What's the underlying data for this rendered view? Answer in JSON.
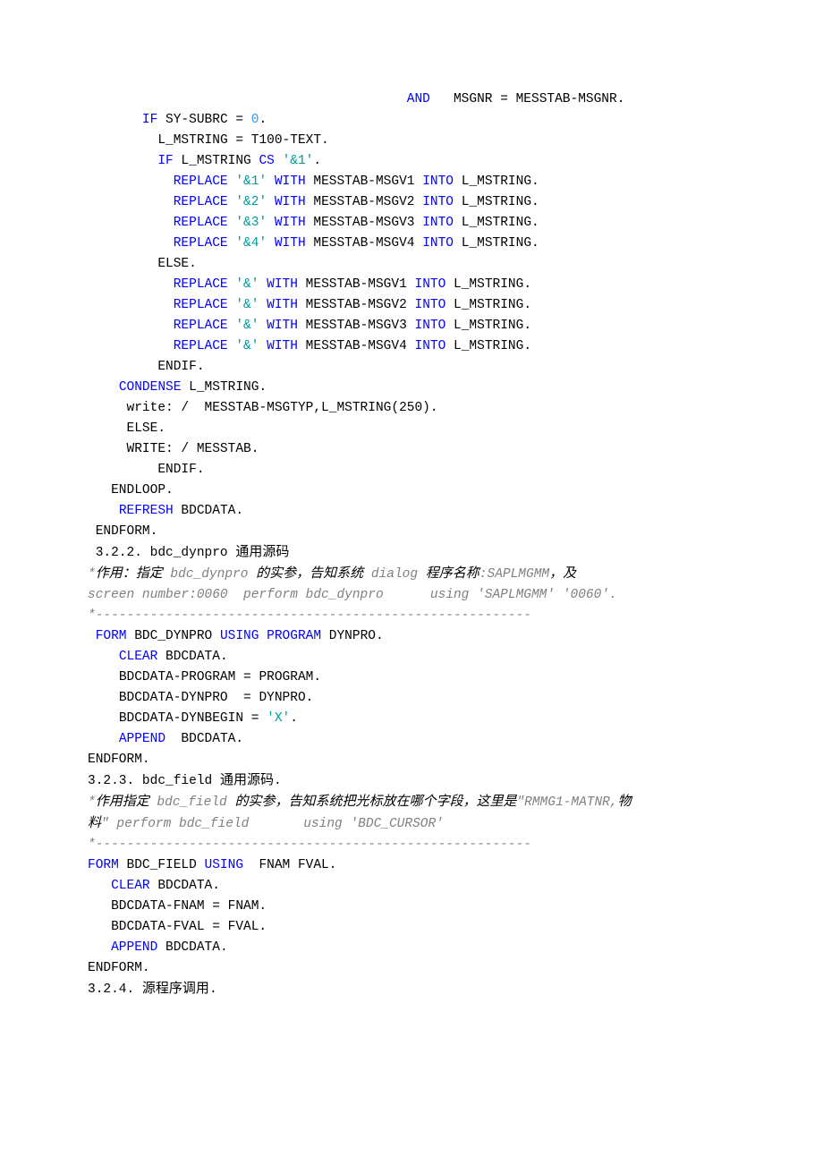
{
  "lines": [
    {
      "indent": 41,
      "spans": [
        {
          "cls": "kw",
          "t": "AND"
        },
        {
          "cls": "",
          "t": "   MSGNR = MESSTAB-MSGNR."
        }
      ]
    },
    {
      "indent": 7,
      "spans": [
        {
          "cls": "kw",
          "t": "IF"
        },
        {
          "cls": "",
          "t": " SY-SUBRC = "
        },
        {
          "cls": "num",
          "t": "0"
        },
        {
          "cls": "",
          "t": "."
        }
      ]
    },
    {
      "indent": 9,
      "spans": [
        {
          "cls": "",
          "t": "L_MSTRING = T100-TEXT."
        }
      ]
    },
    {
      "indent": 9,
      "spans": [
        {
          "cls": "kw",
          "t": "IF"
        },
        {
          "cls": "",
          "t": " L_MSTRING "
        },
        {
          "cls": "kw",
          "t": "CS"
        },
        {
          "cls": "",
          "t": " "
        },
        {
          "cls": "str",
          "t": "'&1'"
        },
        {
          "cls": "",
          "t": "."
        }
      ]
    },
    {
      "indent": 11,
      "spans": [
        {
          "cls": "kw",
          "t": "REPLACE"
        },
        {
          "cls": "",
          "t": " "
        },
        {
          "cls": "str",
          "t": "'&1'"
        },
        {
          "cls": "",
          "t": " "
        },
        {
          "cls": "kw",
          "t": "WITH"
        },
        {
          "cls": "",
          "t": " MESSTAB-MSGV1 "
        },
        {
          "cls": "kw",
          "t": "INTO"
        },
        {
          "cls": "",
          "t": " L_MSTRING."
        }
      ]
    },
    {
      "indent": 11,
      "spans": [
        {
          "cls": "kw",
          "t": "REPLACE"
        },
        {
          "cls": "",
          "t": " "
        },
        {
          "cls": "str",
          "t": "'&2'"
        },
        {
          "cls": "",
          "t": " "
        },
        {
          "cls": "kw",
          "t": "WITH"
        },
        {
          "cls": "",
          "t": " MESSTAB-MSGV2 "
        },
        {
          "cls": "kw",
          "t": "INTO"
        },
        {
          "cls": "",
          "t": " L_MSTRING."
        }
      ]
    },
    {
      "indent": 11,
      "spans": [
        {
          "cls": "kw",
          "t": "REPLACE"
        },
        {
          "cls": "",
          "t": " "
        },
        {
          "cls": "str",
          "t": "'&3'"
        },
        {
          "cls": "",
          "t": " "
        },
        {
          "cls": "kw",
          "t": "WITH"
        },
        {
          "cls": "",
          "t": " MESSTAB-MSGV3 "
        },
        {
          "cls": "kw",
          "t": "INTO"
        },
        {
          "cls": "",
          "t": " L_MSTRING."
        }
      ]
    },
    {
      "indent": 11,
      "spans": [
        {
          "cls": "kw",
          "t": "REPLACE"
        },
        {
          "cls": "",
          "t": " "
        },
        {
          "cls": "str",
          "t": "'&4'"
        },
        {
          "cls": "",
          "t": " "
        },
        {
          "cls": "kw",
          "t": "WITH"
        },
        {
          "cls": "",
          "t": " MESSTAB-MSGV4 "
        },
        {
          "cls": "kw",
          "t": "INTO"
        },
        {
          "cls": "",
          "t": " L_MSTRING."
        }
      ]
    },
    {
      "indent": 9,
      "spans": [
        {
          "cls": "",
          "t": "ELSE."
        }
      ]
    },
    {
      "indent": 11,
      "spans": [
        {
          "cls": "kw",
          "t": "REPLACE"
        },
        {
          "cls": "",
          "t": " "
        },
        {
          "cls": "str",
          "t": "'&'"
        },
        {
          "cls": "",
          "t": " "
        },
        {
          "cls": "kw",
          "t": "WITH"
        },
        {
          "cls": "",
          "t": " MESSTAB-MSGV1 "
        },
        {
          "cls": "kw",
          "t": "INTO"
        },
        {
          "cls": "",
          "t": " L_MSTRING."
        }
      ]
    },
    {
      "indent": 11,
      "spans": [
        {
          "cls": "kw",
          "t": "REPLACE"
        },
        {
          "cls": "",
          "t": " "
        },
        {
          "cls": "str",
          "t": "'&'"
        },
        {
          "cls": "",
          "t": " "
        },
        {
          "cls": "kw",
          "t": "WITH"
        },
        {
          "cls": "",
          "t": " MESSTAB-MSGV2 "
        },
        {
          "cls": "kw",
          "t": "INTO"
        },
        {
          "cls": "",
          "t": " L_MSTRING."
        }
      ]
    },
    {
      "indent": 11,
      "spans": [
        {
          "cls": "kw",
          "t": "REPLACE"
        },
        {
          "cls": "",
          "t": " "
        },
        {
          "cls": "str",
          "t": "'&'"
        },
        {
          "cls": "",
          "t": " "
        },
        {
          "cls": "kw",
          "t": "WITH"
        },
        {
          "cls": "",
          "t": " MESSTAB-MSGV3 "
        },
        {
          "cls": "kw",
          "t": "INTO"
        },
        {
          "cls": "",
          "t": " L_MSTRING."
        }
      ]
    },
    {
      "indent": 11,
      "spans": [
        {
          "cls": "kw",
          "t": "REPLACE"
        },
        {
          "cls": "",
          "t": " "
        },
        {
          "cls": "str",
          "t": "'&'"
        },
        {
          "cls": "",
          "t": " "
        },
        {
          "cls": "kw",
          "t": "WITH"
        },
        {
          "cls": "",
          "t": " MESSTAB-MSGV4 "
        },
        {
          "cls": "kw",
          "t": "INTO"
        },
        {
          "cls": "",
          "t": " L_MSTRING."
        }
      ]
    },
    {
      "indent": 9,
      "spans": [
        {
          "cls": "",
          "t": "ENDIF."
        }
      ]
    },
    {
      "indent": 4,
      "spans": [
        {
          "cls": "kw",
          "t": "CONDENSE"
        },
        {
          "cls": "",
          "t": " L_MSTRING."
        }
      ]
    },
    {
      "indent": 5,
      "spans": [
        {
          "cls": "",
          "t": "write: /  MESSTAB-MSGTYP,L_MSTRING(250)."
        }
      ]
    },
    {
      "indent": 5,
      "spans": [
        {
          "cls": "",
          "t": "ELSE."
        }
      ]
    },
    {
      "indent": 5,
      "spans": [
        {
          "cls": "",
          "t": "WRITE: / MESSTAB."
        }
      ]
    },
    {
      "indent": 9,
      "spans": [
        {
          "cls": "",
          "t": "ENDIF."
        }
      ]
    },
    {
      "indent": 3,
      "spans": [
        {
          "cls": "",
          "t": "ENDLOOP."
        }
      ]
    },
    {
      "indent": 4,
      "spans": [
        {
          "cls": "kw",
          "t": "REFRESH"
        },
        {
          "cls": "",
          "t": " BDCDATA."
        }
      ]
    },
    {
      "indent": 1,
      "spans": [
        {
          "cls": "",
          "t": "ENDFORM."
        }
      ]
    },
    {
      "indent": 1,
      "spans": [
        {
          "cls": "",
          "t": "3.2.2. bdc_dynpro "
        },
        {
          "cls": "cn",
          "t": "通用源码"
        }
      ]
    },
    {
      "indent": 0,
      "spans": [
        {
          "cls": "cm",
          "t": "*"
        },
        {
          "cls": "cncm",
          "t": "作用：指定"
        },
        {
          "cls": "cm",
          "t": " bdc_dynpro "
        },
        {
          "cls": "cncm",
          "t": "的实参，告知系统"
        },
        {
          "cls": "cm",
          "t": " dialog "
        },
        {
          "cls": "cncm",
          "t": "程序名称"
        },
        {
          "cls": "cm",
          "t": ":SAPLMGMM"
        },
        {
          "cls": "cncm",
          "t": "，及"
        }
      ]
    },
    {
      "indent": 0,
      "spans": [
        {
          "cls": "cm",
          "t": "screen number:0060  perform bdc_dynpro      using 'SAPLMGMM' '0060'."
        }
      ]
    },
    {
      "indent": 0,
      "spans": [
        {
          "cls": "cm",
          "t": "*--------------------------------------------------------"
        }
      ]
    },
    {
      "indent": 1,
      "spans": [
        {
          "cls": "kw",
          "t": "FORM"
        },
        {
          "cls": "",
          "t": " BDC_DYNPRO "
        },
        {
          "cls": "kw",
          "t": "USING"
        },
        {
          "cls": "",
          "t": " "
        },
        {
          "cls": "kw",
          "t": "PROGRAM"
        },
        {
          "cls": "",
          "t": " DYNPRO."
        }
      ]
    },
    {
      "indent": 4,
      "spans": [
        {
          "cls": "kw",
          "t": "CLEAR"
        },
        {
          "cls": "",
          "t": " BDCDATA."
        }
      ]
    },
    {
      "indent": 4,
      "spans": [
        {
          "cls": "",
          "t": "BDCDATA-PROGRAM = PROGRAM."
        }
      ]
    },
    {
      "indent": 4,
      "spans": [
        {
          "cls": "",
          "t": "BDCDATA-DYNPRO  = DYNPRO."
        }
      ]
    },
    {
      "indent": 4,
      "spans": [
        {
          "cls": "",
          "t": "BDCDATA-DYNBEGIN = "
        },
        {
          "cls": "str",
          "t": "'X'"
        },
        {
          "cls": "",
          "t": "."
        }
      ]
    },
    {
      "indent": 4,
      "spans": [
        {
          "cls": "kw",
          "t": "APPEND"
        },
        {
          "cls": "",
          "t": "  BDCDATA."
        }
      ]
    },
    {
      "indent": 0,
      "spans": [
        {
          "cls": "",
          "t": "ENDFORM."
        }
      ]
    },
    {
      "indent": 0,
      "spans": [
        {
          "cls": "",
          "t": "3.2.3. bdc_field "
        },
        {
          "cls": "cn",
          "t": "通用源码"
        },
        {
          "cls": "",
          "t": "."
        }
      ]
    },
    {
      "indent": 0,
      "spans": [
        {
          "cls": "cm",
          "t": "*"
        },
        {
          "cls": "cncm",
          "t": "作用指定"
        },
        {
          "cls": "cm",
          "t": " bdc_field "
        },
        {
          "cls": "cncm",
          "t": "的实参，告知系统把光标放在哪个字段，这里是"
        },
        {
          "cls": "cm",
          "t": "\"RMMG1-MATNR,"
        },
        {
          "cls": "cncm",
          "t": "物"
        }
      ]
    },
    {
      "indent": 0,
      "spans": [
        {
          "cls": "cncm",
          "t": "料"
        },
        {
          "cls": "cm",
          "t": "\" perform bdc_field       using 'BDC_CURSOR'"
        }
      ]
    },
    {
      "indent": 0,
      "spans": [
        {
          "cls": "cm",
          "t": "*--------------------------------------------------------"
        }
      ]
    },
    {
      "indent": 0,
      "spans": [
        {
          "cls": "kw",
          "t": "FORM"
        },
        {
          "cls": "",
          "t": " BDC_FIELD "
        },
        {
          "cls": "kw",
          "t": "USING"
        },
        {
          "cls": "",
          "t": "  FNAM FVAL."
        }
      ]
    },
    {
      "indent": 3,
      "spans": [
        {
          "cls": "kw",
          "t": "CLEAR"
        },
        {
          "cls": "",
          "t": " BDCDATA."
        }
      ]
    },
    {
      "indent": 3,
      "spans": [
        {
          "cls": "",
          "t": "BDCDATA-FNAM = FNAM."
        }
      ]
    },
    {
      "indent": 3,
      "spans": [
        {
          "cls": "",
          "t": "BDCDATA-FVAL = FVAL."
        }
      ]
    },
    {
      "indent": 3,
      "spans": [
        {
          "cls": "kw",
          "t": "APPEND"
        },
        {
          "cls": "",
          "t": " BDCDATA."
        }
      ]
    },
    {
      "indent": 0,
      "spans": [
        {
          "cls": "",
          "t": "ENDFORM."
        }
      ]
    },
    {
      "indent": 0,
      "spans": [
        {
          "cls": "",
          "t": "3.2.4. "
        },
        {
          "cls": "cn",
          "t": "源程序调用"
        },
        {
          "cls": "",
          "t": "."
        }
      ]
    }
  ]
}
